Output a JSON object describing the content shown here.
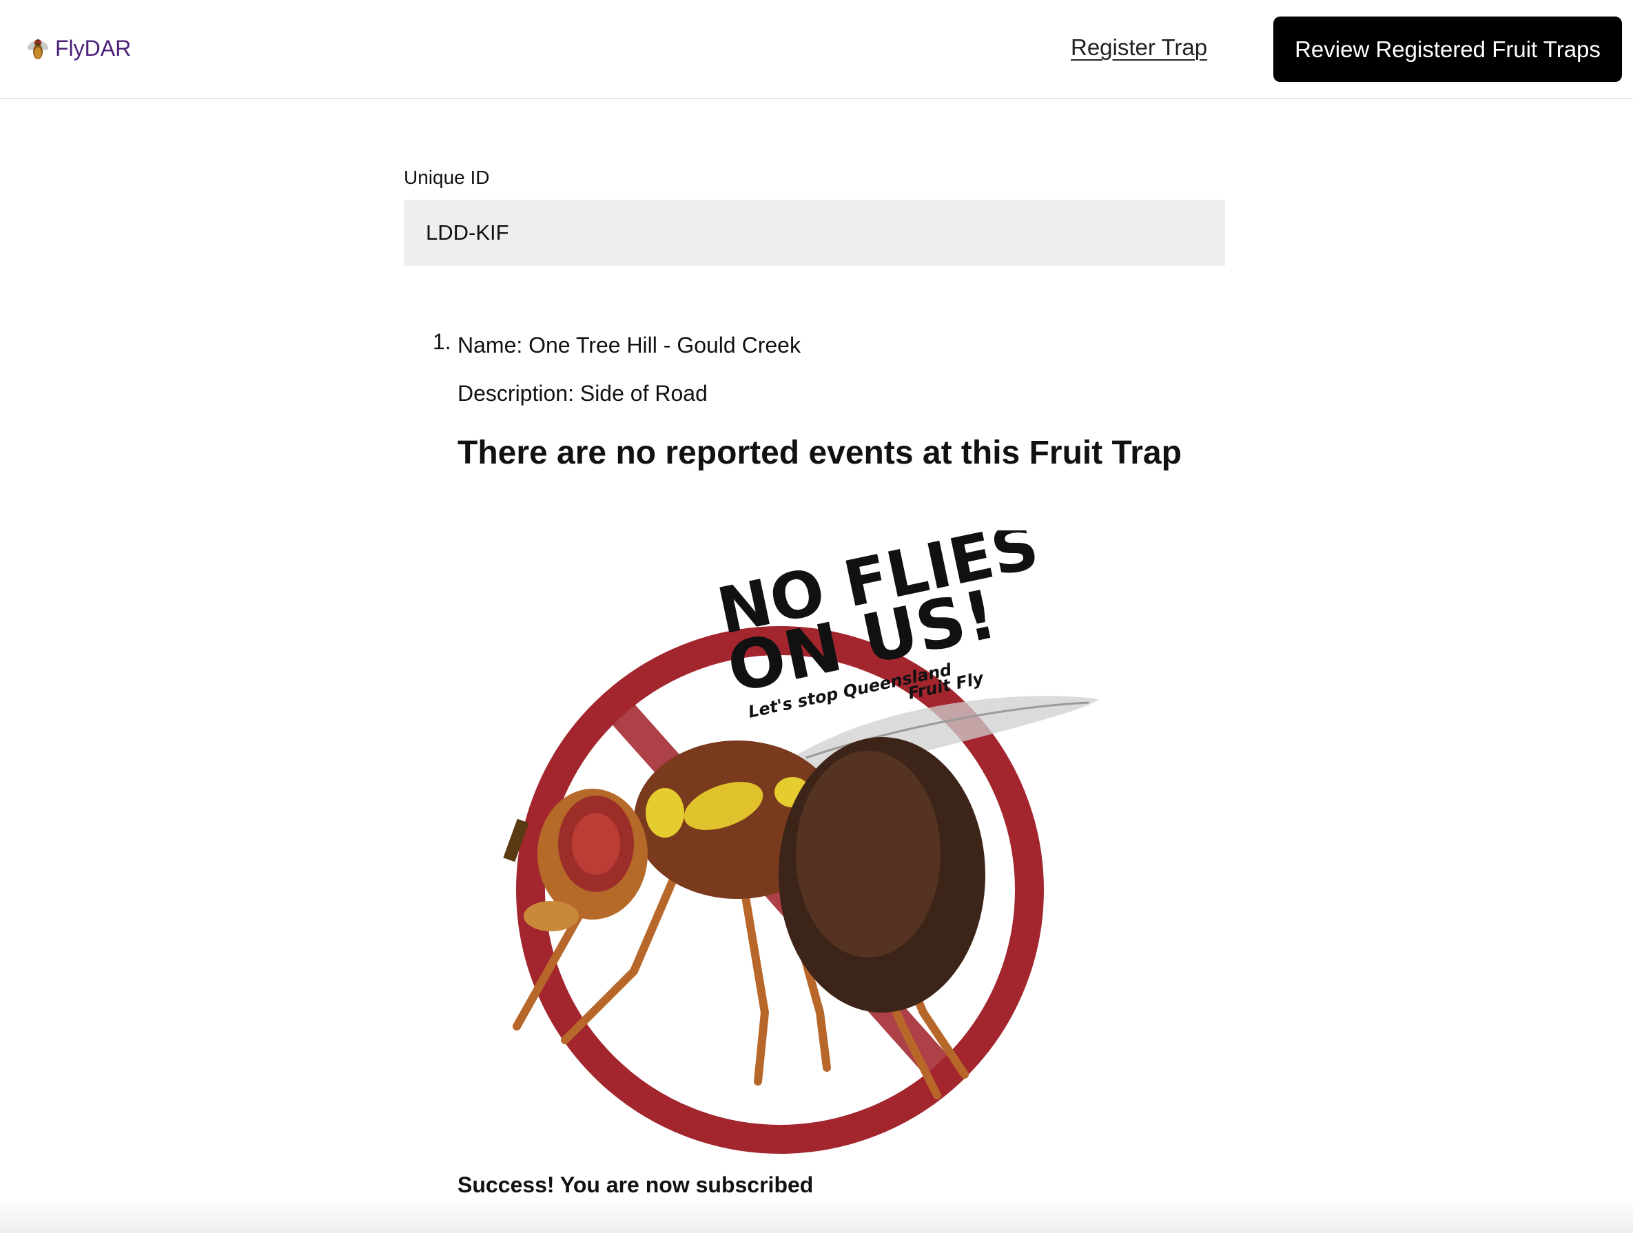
{
  "header": {
    "brand": "FlyDAR",
    "brand_icon": "fly-icon",
    "register_link": "Register Trap",
    "review_button": "Review Registered Fruit Traps"
  },
  "form": {
    "unique_id_label": "Unique ID",
    "unique_id_value": "LDD-KIF"
  },
  "trap": {
    "number": "1.",
    "name": "Name: One Tree Hill - Gould Creek",
    "description": "Description: Side of Road",
    "no_events_message": "There are no reported events at this Fruit Trap"
  },
  "logo": {
    "line1": "NO FLIES",
    "line2": "ON US!",
    "tagline1": "Let's stop Queensland",
    "tagline2": "Fruit Fly",
    "ring_color": "#a3262e"
  },
  "status": {
    "message": "Success! You are now subscribed"
  }
}
